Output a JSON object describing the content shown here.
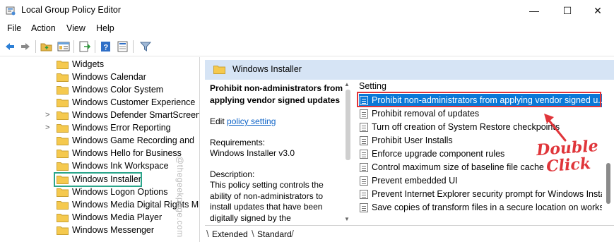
{
  "window": {
    "title": "Local Group Policy Editor",
    "minimize_glyph": "—",
    "maximize_glyph": "☐",
    "close_glyph": "✕"
  },
  "menu": [
    "File",
    "Action",
    "View",
    "Help"
  ],
  "toolbar": {
    "icons": [
      "back-arrow-icon",
      "forward-arrow-icon",
      "up-folder-icon",
      "show-hide-tree-icon",
      "export-list-icon",
      "help-icon",
      "properties-icon",
      "filter-icon"
    ]
  },
  "tree": {
    "items": [
      {
        "label": "Widgets",
        "expander": ""
      },
      {
        "label": "Windows Calendar",
        "expander": ""
      },
      {
        "label": "Windows Color System",
        "expander": ""
      },
      {
        "label": "Windows Customer Experience",
        "expander": ""
      },
      {
        "label": "Windows Defender SmartScreen",
        "expander": ">"
      },
      {
        "label": "Windows Error Reporting",
        "expander": ">"
      },
      {
        "label": "Windows Game Recording and",
        "expander": ""
      },
      {
        "label": "Windows Hello for Business",
        "expander": ""
      },
      {
        "label": "Windows Ink Workspace",
        "expander": ""
      },
      {
        "label": "Windows Installer",
        "expander": ""
      },
      {
        "label": "Windows Logon Options",
        "expander": ""
      },
      {
        "label": "Windows Media Digital Rights M",
        "expander": ""
      },
      {
        "label": "Windows Media Player",
        "expander": ""
      },
      {
        "label": "Windows Messenger",
        "expander": ""
      }
    ],
    "selected_index": 9,
    "watermark": "@thegeekpage.com"
  },
  "panel": {
    "header": "Windows Installer",
    "description": {
      "title": "Prohibit non-administrators from applying vendor signed updates",
      "edit_prefix": "Edit ",
      "edit_link": "policy setting",
      "requirements_label": "Requirements:",
      "requirements_value": "Windows Installer v3.0",
      "description_label": "Description:",
      "description_text": "This policy setting controls the ability of non-administrators to install updates that have been digitally signed by the application vendor."
    },
    "list": {
      "column_header": "Setting",
      "rows": [
        "Prohibit non-administrators from applying vendor signed u...",
        "Prohibit removal of updates",
        "Turn off creation of System Restore checkpoints",
        "Prohibit User Installs",
        "Enforce upgrade component rules",
        "Control maximum size of baseline file cache",
        "Prevent embedded UI",
        "Prevent Internet Explorer security prompt for Windows Insta...",
        "Save copies of transform files in a secure location on workst..."
      ],
      "highlighted_index": 0
    },
    "annotation": {
      "line1": "Double",
      "line2": "Click",
      "color": "#e0353a"
    },
    "tabs": [
      "Extended",
      "Standard"
    ]
  },
  "colors": {
    "selection_blue": "#0a78d7",
    "header_blue": "#d6e4f5",
    "highlight_green": "#2ba58a",
    "link_blue": "#0d63c7"
  }
}
